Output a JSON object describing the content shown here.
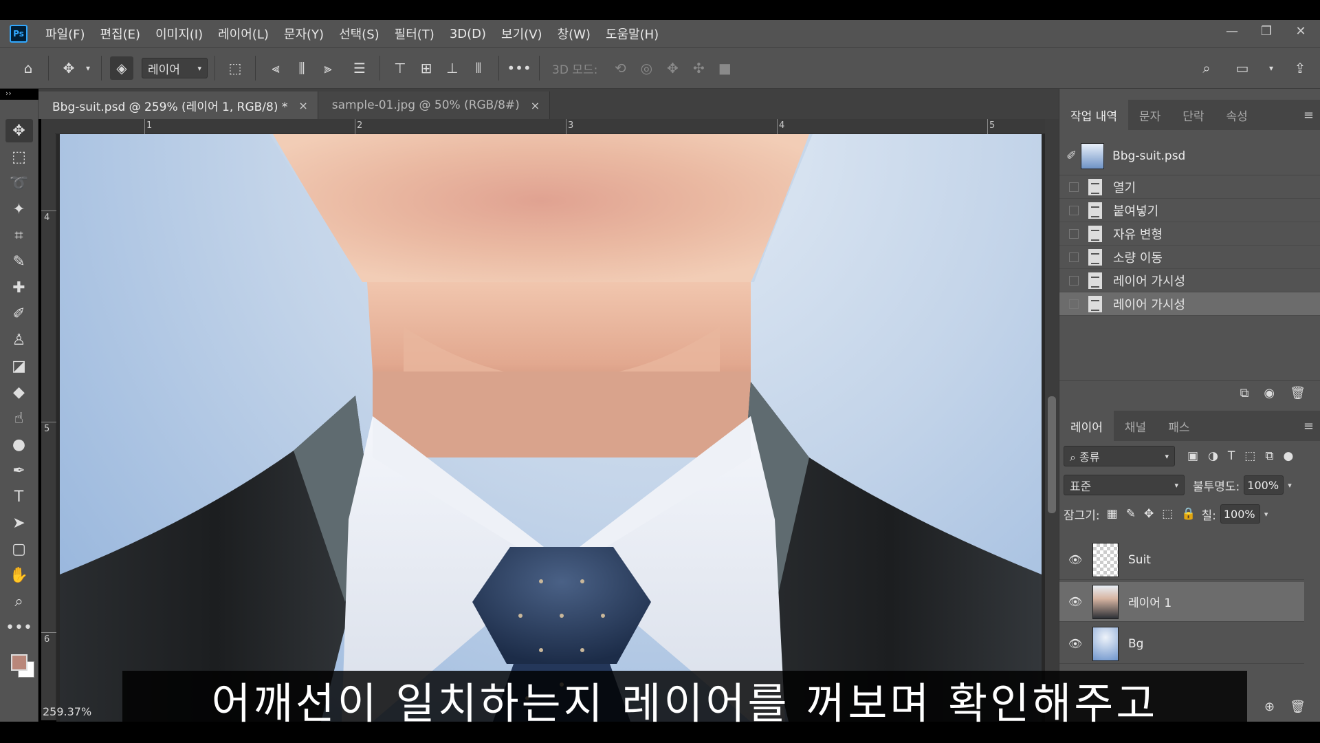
{
  "menubar": {
    "logo": "Ps",
    "items": [
      "파일(F)",
      "편집(E)",
      "이미지(I)",
      "레이어(L)",
      "문자(Y)",
      "선택(S)",
      "필터(T)",
      "3D(D)",
      "보기(V)",
      "창(W)",
      "도움말(H)"
    ]
  },
  "options": {
    "auto_select_target": "레이어",
    "mode_3d_label": "3D 모드:"
  },
  "tabs": [
    {
      "label": "Bbg-suit.psd @ 259% (레이어 1, RGB/8) *",
      "close": "×"
    },
    {
      "label": "sample-01.jpg @ 50% (RGB/8#)",
      "close": "×"
    }
  ],
  "rulers": {
    "h_numbers": [
      "1",
      "2",
      "3",
      "4",
      "5"
    ],
    "v_numbers": [
      "4",
      "5",
      "6"
    ]
  },
  "status": {
    "zoom": "259.37%"
  },
  "history_panel": {
    "tabs": [
      "작업 내역",
      "문자",
      "단락",
      "속성"
    ],
    "source_name": "Bbg-suit.psd",
    "steps": [
      "열기",
      "붙여넣기",
      "자유 변형",
      "소량 이동",
      "레이어 가시성",
      "레이어 가시성"
    ],
    "selected_index": 5
  },
  "layers_panel": {
    "tabs": [
      "레이어",
      "채널",
      "패스"
    ],
    "kind_filter": "종류",
    "blend_mode": "표준",
    "opacity_label": "불투명도:",
    "opacity_value": "100%",
    "lock_label": "잠그기:",
    "fill_label": "칠:",
    "fill_value": "100%",
    "layers": [
      {
        "name": "Suit",
        "visible": true
      },
      {
        "name": "레이어 1",
        "visible": true,
        "selected": true
      },
      {
        "name": "Bg",
        "visible": true
      }
    ]
  },
  "subtitle": "어깨선이 일치하는지 레이어를 꺼보며 확인해주고",
  "colors": {
    "foreground": "#b9877a",
    "background": "#ffffff",
    "panel": "#535353",
    "accent": "#31a8ff"
  }
}
